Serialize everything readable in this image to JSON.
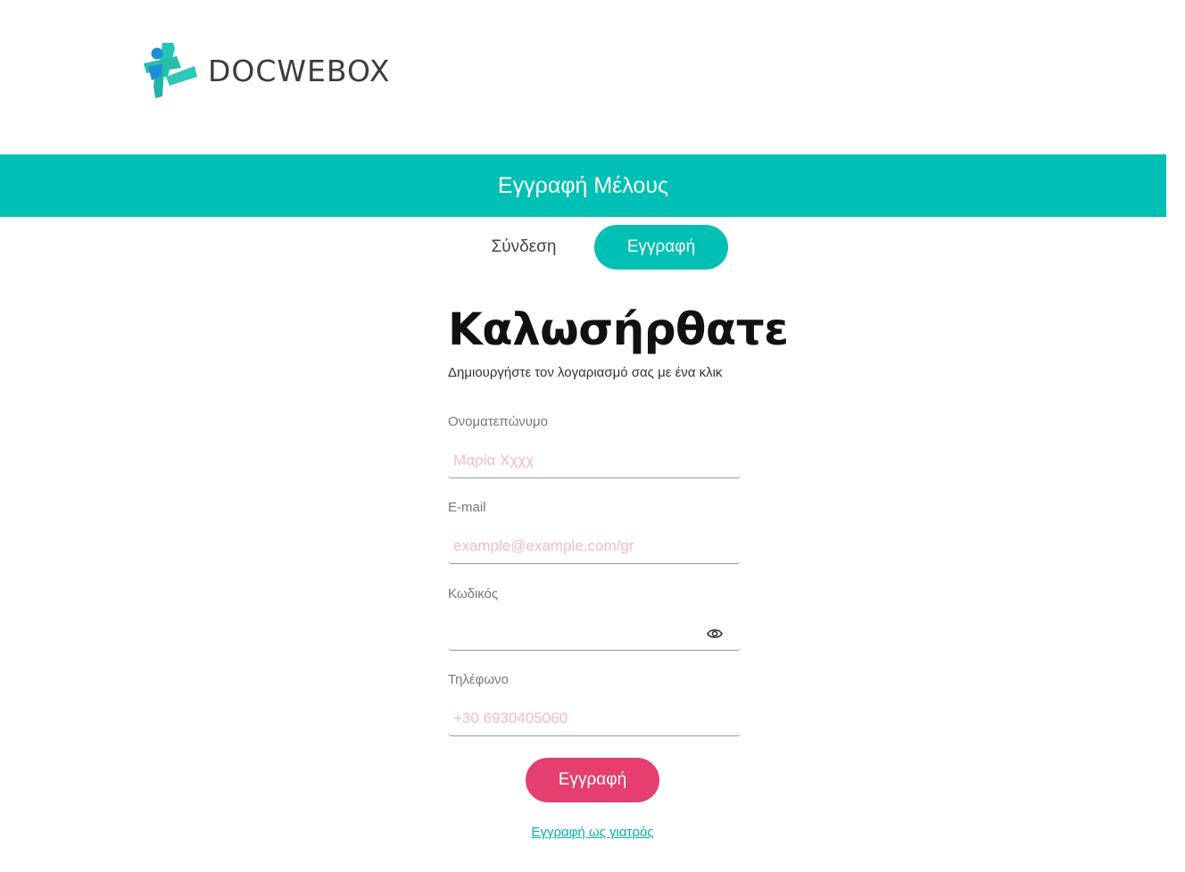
{
  "brand": {
    "name": "DOCWEBOX",
    "colors": {
      "teal": "#00bfb5",
      "pink": "#e43f6f",
      "logo_blue": "#1e8fd6"
    }
  },
  "banner": {
    "title": "Εγγραφή Μέλους"
  },
  "tabs": {
    "login": "Σύνδεση",
    "register": "Εγγραφή",
    "active": "register"
  },
  "form": {
    "heading": "Καλωσήρθατε",
    "subtitle": "Δημιουργήστε τον λογαριασμό σας με ένα κλικ",
    "fields": {
      "fullname": {
        "label": "Ονοματεπώνυμο",
        "placeholder": "Μαρία Χχχχ",
        "value": ""
      },
      "email": {
        "label": "E-mail",
        "placeholder": "example@example.com/gr",
        "value": ""
      },
      "password": {
        "label": "Κωδικός",
        "placeholder": "",
        "value": "",
        "toggle_icon": "eye-icon"
      },
      "phone": {
        "label": "Τηλέφωνο",
        "placeholder": "+30 6930405060",
        "value": ""
      }
    },
    "submit_label": "Εγγραφή",
    "doctor_link": "Εγγραφή ως γιατρός"
  }
}
